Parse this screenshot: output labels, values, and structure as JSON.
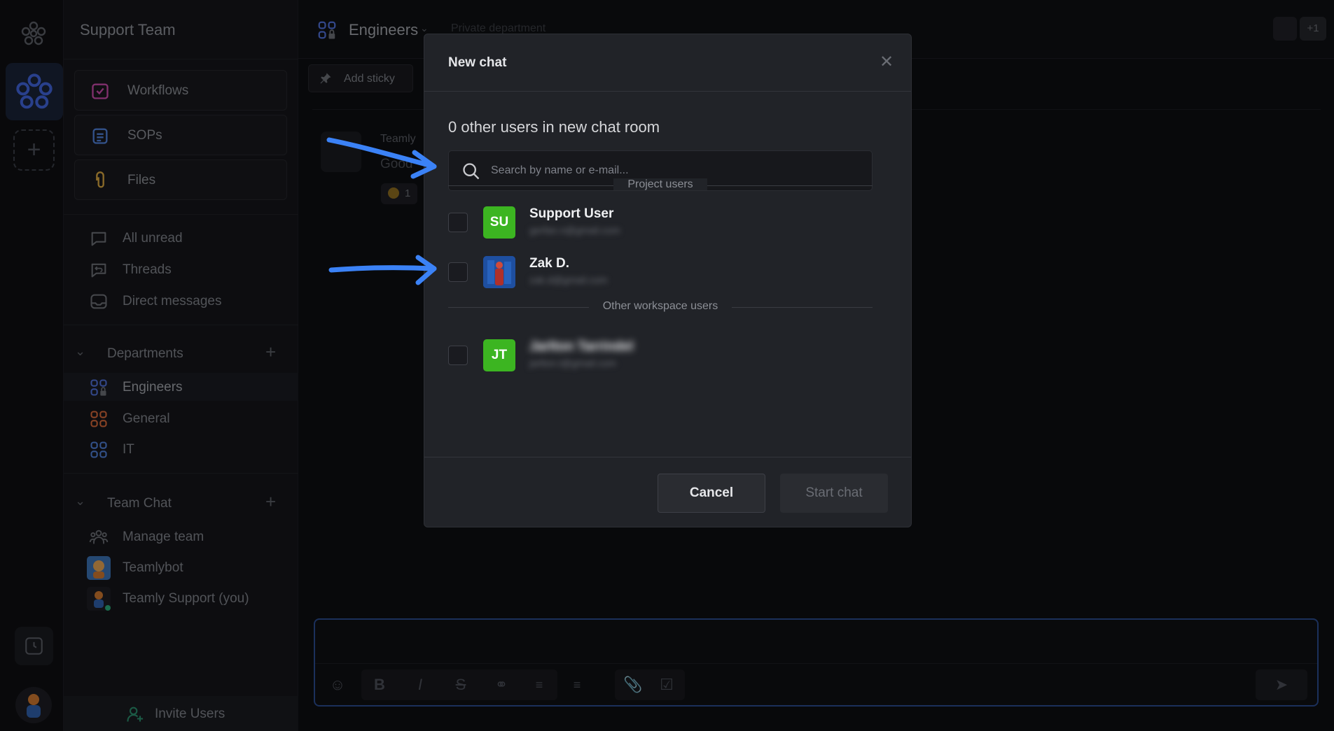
{
  "workspace": {
    "title": "Support Team"
  },
  "sidebar": {
    "top_buttons": [
      {
        "label": "Workflows",
        "icon": "workflow-icon",
        "color": "#c74aa8"
      },
      {
        "label": "SOPs",
        "icon": "clipboard-icon",
        "color": "#4f7fd6"
      },
      {
        "label": "Files",
        "icon": "paperclip-icon",
        "color": "#d4a440"
      }
    ],
    "nav": [
      {
        "label": "All unread",
        "icon": "chat-bubble-icon"
      },
      {
        "label": "Threads",
        "icon": "threads-icon"
      },
      {
        "label": "Direct messages",
        "icon": "inbox-icon"
      }
    ],
    "departments": {
      "label": "Departments",
      "items": [
        {
          "label": "Engineers",
          "icon": "department-locked-icon",
          "color": "#4f6fd6"
        },
        {
          "label": "General",
          "icon": "department-icon",
          "color": "#d4683a"
        },
        {
          "label": "IT",
          "icon": "department-icon",
          "color": "#4f7fd6"
        }
      ]
    },
    "team_chat": {
      "label": "Team Chat",
      "items": [
        {
          "label": "Manage team",
          "icon": "team-icon"
        },
        {
          "label": "Teamlybot",
          "icon": "bot-avatar"
        },
        {
          "label": "Teamly Support (you)",
          "icon": "user-avatar"
        }
      ]
    },
    "invite_label": "Invite Users"
  },
  "topbar": {
    "department": "Engineers",
    "subtitle": "Private department",
    "extra_members": "+1"
  },
  "toolbar": {
    "add_sticky": "Add sticky"
  },
  "message": {
    "author": "Teamly",
    "text": "Good",
    "reaction_count": "1"
  },
  "modal": {
    "title": "New chat",
    "count_text": "0 other users in new chat room",
    "search_placeholder": "Search by name or e-mail...",
    "project_users_label": "Project users",
    "other_users_label": "Other workspace users",
    "project_users": [
      {
        "initials": "SU",
        "name": "Support User",
        "email": "gerfan.n@gmail.com",
        "avatar_color": "#3cb521"
      },
      {
        "initials": "",
        "name": "Zak D.",
        "email": "zak.d@gmail.com",
        "avatar_color": "#1f4fa8"
      }
    ],
    "other_users": [
      {
        "initials": "JT",
        "name": "Jarlton Tarrindel",
        "email": "jarlton.t@gmail.com",
        "avatar_color": "#3cb521"
      }
    ],
    "cancel_label": "Cancel",
    "start_label": "Start chat"
  },
  "colors": {
    "accent_arrow": "#3b82f6",
    "composer_border": "#2a4a8c"
  }
}
